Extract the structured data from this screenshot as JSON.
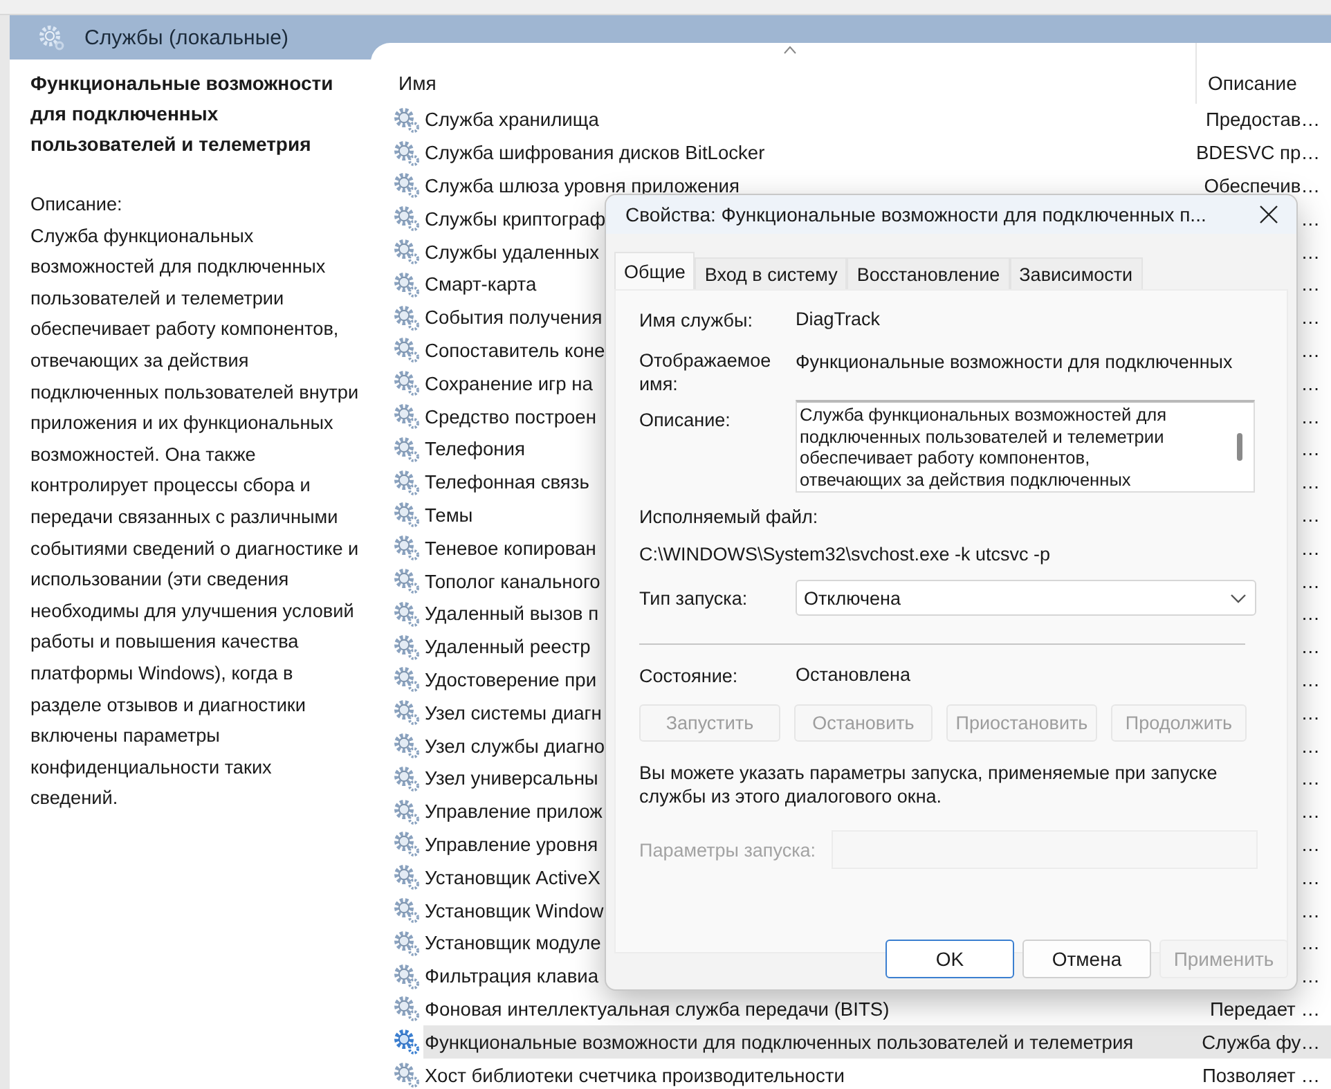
{
  "console": {
    "title": "Службы (локальные)"
  },
  "detail_panel": {
    "service_name": "Функциональные возможности для подключенных пользователей и телеметрия",
    "description_label": "Описание:",
    "description": "Служба функциональных возможностей для подключенных пользователей и телеметрии обеспечивает работу компонентов, отвечающих за действия подключенных пользователей внутри приложения и их функциональных возможностей. Она также контролирует процессы сбора и передачи связанных с различными событиями сведений о диагностике и использовании (эти сведения необходимы для улучшения условий работы и повышения качества платформы Windows), когда в разделе отзывов и диагностики включены параметры конфиденциальности таких сведений."
  },
  "list": {
    "columns": [
      {
        "label": "Имя",
        "sorted": true
      },
      {
        "label": "Описание",
        "sorted": false
      }
    ],
    "rows": [
      {
        "name": "Служба хранилища",
        "description": "Предостав…",
        "selected": false
      },
      {
        "name": "Служба шифрования дисков BitLocker",
        "description": "BDESVC пр…",
        "selected": false
      },
      {
        "name": "Служба шлюза уровня приложения",
        "description": "Обеспечив…",
        "selected": false
      },
      {
        "name": "Службы криптограф",
        "description": "…",
        "selected": false
      },
      {
        "name": "Службы удаленных",
        "description": "…",
        "selected": false
      },
      {
        "name": "Смарт-карта",
        "description": "…",
        "selected": false
      },
      {
        "name": "События получения",
        "description": "…",
        "selected": false
      },
      {
        "name": "Сопоставитель коне",
        "description": "…",
        "selected": false
      },
      {
        "name": "Сохранение игр на",
        "description": "…",
        "selected": false
      },
      {
        "name": "Средство построен",
        "description": "…",
        "selected": false
      },
      {
        "name": "Телефония",
        "description": "…",
        "selected": false
      },
      {
        "name": "Телефонная связь",
        "description": "…",
        "selected": false
      },
      {
        "name": "Темы",
        "description": "…",
        "selected": false
      },
      {
        "name": "Теневое копирован",
        "description": "…",
        "selected": false
      },
      {
        "name": "Тополог канального",
        "description": "…",
        "selected": false
      },
      {
        "name": "Удаленный вызов п",
        "description": "…",
        "selected": false
      },
      {
        "name": "Удаленный реестр",
        "description": "…",
        "selected": false
      },
      {
        "name": "Удостоверение при",
        "description": "…",
        "selected": false
      },
      {
        "name": "Узел системы диагн",
        "description": "…",
        "selected": false
      },
      {
        "name": "Узел службы диагно",
        "description": "…",
        "selected": false
      },
      {
        "name": "Узел универсальны",
        "description": "…",
        "selected": false
      },
      {
        "name": "Управление прилож",
        "description": "…",
        "selected": false
      },
      {
        "name": "Управление уровня",
        "description": "…",
        "selected": false
      },
      {
        "name": "Установщик ActiveX",
        "description": "…",
        "selected": false
      },
      {
        "name": "Установщик Window",
        "description": "…",
        "selected": false
      },
      {
        "name": "Установщик модуле",
        "description": "…",
        "selected": false
      },
      {
        "name": "Фильтрация клавиа",
        "description": "…",
        "selected": false
      },
      {
        "name": "Фоновая интеллектуальная служба передачи (BITS)",
        "description": "Передает …",
        "selected": false
      },
      {
        "name": "Функциональные возможности для подключенных пользователей и телеметрия",
        "description": "Служба фу…",
        "selected": true
      },
      {
        "name": "Хост библиотеки счетчика производительности",
        "description": "Позволяет …",
        "selected": false
      }
    ]
  },
  "dialog": {
    "title": "Свойства: Функциональные возможности для подключенных п...",
    "tabs": [
      {
        "label": "Общие",
        "selected": true
      },
      {
        "label": "Вход в систему",
        "selected": false
      },
      {
        "label": "Восстановление",
        "selected": false
      },
      {
        "label": "Зависимости",
        "selected": false
      }
    ],
    "service_name_label": "Имя службы:",
    "service_name": "DiagTrack",
    "display_name_label": "Отображаемое имя:",
    "display_name": "Функциональные возможности для подключенных",
    "description_label": "Описание:",
    "description": "Служба функциональных возможностей для\nподключенных пользователей и телеметрии\nобеспечивает работу компонентов,\nотвечающих за действия подключенных",
    "executable_label": "Исполняемый файл:",
    "executable": "C:\\WINDOWS\\System32\\svchost.exe -k utcsvc -p",
    "startup_type_label": "Тип запуска:",
    "startup_type": "Отключена",
    "status_label": "Состояние:",
    "status": "Остановлена",
    "service_buttons": [
      {
        "label": "Запустить",
        "disabled": true
      },
      {
        "label": "Остановить",
        "disabled": true
      },
      {
        "label": "Приостановить",
        "disabled": true
      },
      {
        "label": "Продолжить",
        "disabled": true
      }
    ],
    "hint": "Вы можете указать параметры запуска, применяемые при запуске службы из этого диалогового окна.",
    "start_params": {
      "label": "Параметры запуска:",
      "disabled": true
    },
    "buttons": [
      {
        "label": "OK",
        "default": true,
        "disabled": false
      },
      {
        "label": "Отмена",
        "default": false,
        "disabled": false
      },
      {
        "label": "Применить",
        "default": false,
        "disabled": true
      }
    ]
  }
}
